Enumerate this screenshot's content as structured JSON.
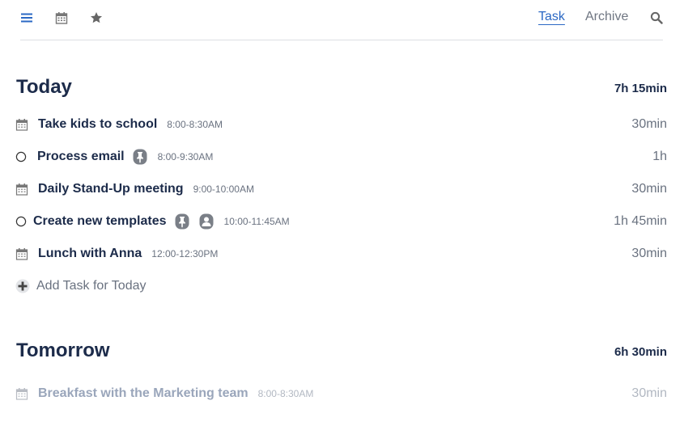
{
  "nav": {
    "icons": [
      "hamburger-menu-icon",
      "calendar-icon",
      "star-icon",
      "search-icon"
    ],
    "tabs": [
      {
        "label": "Task",
        "active": true
      },
      {
        "label": "Archive",
        "active": false
      }
    ],
    "accent_color": "#2b68c4"
  },
  "today": {
    "title": "Today",
    "total": "7h 15min",
    "tasks": [
      {
        "type": "event",
        "name": "Take kids to school",
        "time": "8:00-8:30AM",
        "duration": "30min"
      },
      {
        "type": "task",
        "name": "Process email",
        "time": "8:00-9:30AM",
        "duration": "1h",
        "badges": [
          "pin-icon"
        ]
      },
      {
        "type": "event",
        "name": "Daily Stand-Up meeting",
        "time": "9:00-10:00AM",
        "duration": "30min"
      },
      {
        "type": "task",
        "name": "Create new templates",
        "time": "10:00-11:45AM",
        "duration": "1h 45min",
        "badges": [
          "pin-icon",
          "person-icon"
        ]
      },
      {
        "type": "event",
        "name": "Lunch with Anna",
        "time": "12:00-12:30PM",
        "duration": "30min"
      }
    ],
    "add_label": "Add Task for Today"
  },
  "tomorrow": {
    "title": "Tomorrow",
    "total": "6h 30min",
    "tasks": [
      {
        "type": "event",
        "name": "Breakfast with the Marketing team",
        "time": "8:00-8:30AM",
        "duration": "30min"
      }
    ]
  }
}
